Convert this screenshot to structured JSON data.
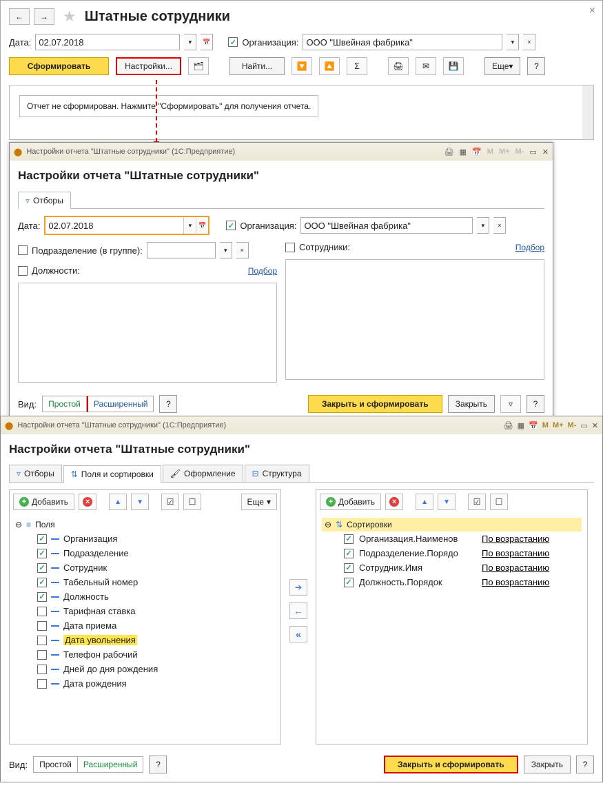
{
  "main": {
    "title": "Штатные сотрудники",
    "date_label": "Дата:",
    "date_value": "02.07.2018",
    "org_label": "Организация:",
    "org_value": "ООО \"Швейная фабрика\"",
    "form_btn": "Сформировать",
    "settings_btn": "Настройки...",
    "find_btn": "Найти...",
    "more_btn": "Еще",
    "help": "?",
    "message": "Отчет не сформирован. Нажмите \"Сформировать\" для получения отчета."
  },
  "win2": {
    "header": "Настройки отчета \"Штатные сотрудники\"  (1С:Предприятие)",
    "title": "Настройки отчета \"Штатные сотрудники\"",
    "tab_filters": "Отборы",
    "date_label": "Дата:",
    "date_value": "02.07.2018",
    "org_label": "Организация:",
    "org_value": "ООО \"Швейная фабрика\"",
    "dept_label": "Подразделение (в группе):",
    "empl_label": "Сотрудники:",
    "pos_label": "Должности:",
    "selection": "Подбор",
    "view_label": "Вид:",
    "simple": "Простой",
    "extended": "Расширенный",
    "close_form": "Закрыть и сформировать",
    "close": "Закрыть",
    "help": "?"
  },
  "win3": {
    "header": "Настройки отчета \"Штатные сотрудники\"  (1С:Предприятие)",
    "title": "Настройки отчета \"Штатные сотрудники\"",
    "tabs": {
      "f": "Отборы",
      "fs": "Поля и сортировки",
      "fmt": "Оформление",
      "str": "Структура"
    },
    "add": "Добавить",
    "more": "Еще",
    "fields_header": "Поля",
    "fields": [
      {
        "chk": true,
        "label": "Организация"
      },
      {
        "chk": true,
        "label": "Подразделение"
      },
      {
        "chk": true,
        "label": "Сотрудник"
      },
      {
        "chk": true,
        "label": "Табельный номер"
      },
      {
        "chk": true,
        "label": "Должность"
      },
      {
        "chk": false,
        "label": "Тарифная ставка"
      },
      {
        "chk": false,
        "label": "Дата приема"
      },
      {
        "chk": false,
        "label": "Дата увольнения",
        "hl": true
      },
      {
        "chk": false,
        "label": "Телефон рабочий"
      },
      {
        "chk": false,
        "label": "Дней до дня рождения"
      },
      {
        "chk": false,
        "label": "Дата рождения"
      }
    ],
    "sort_header": "Сортировки",
    "sorts": [
      {
        "label": "Организация.Наименов",
        "dir": "По возрастанию"
      },
      {
        "label": "Подразделение.Порядо",
        "dir": "По возрастанию"
      },
      {
        "label": "Сотрудник.Имя",
        "dir": "По возрастанию"
      },
      {
        "label": "Должность.Порядок",
        "dir": "По возрастанию"
      }
    ],
    "view_label": "Вид:",
    "simple": "Простой",
    "extended": "Расширенный",
    "close_form": "Закрыть и сформировать",
    "close": "Закрыть",
    "help": "?",
    "m": "M",
    "mp": "M+",
    "mm": "M-"
  }
}
